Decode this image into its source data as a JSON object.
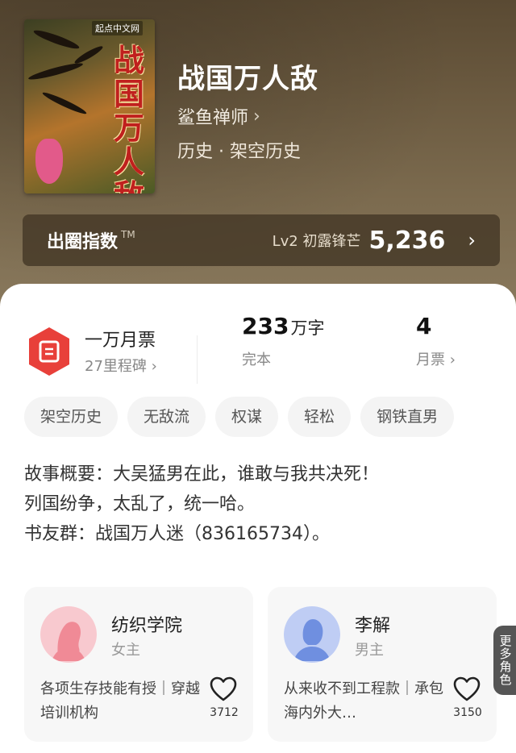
{
  "book": {
    "title": "战国万人敌",
    "author": "鲨鱼禅师",
    "genre": "历史 · 架空历史",
    "cover_art_text": "战国万人敌",
    "cover_publisher": "起点中文网"
  },
  "index_bar": {
    "label": "出圈指数",
    "tm": "TM",
    "level": "Lv2 初露锋芒",
    "value": "5,236"
  },
  "stats": {
    "monthly_badge": "一万月票",
    "milestones": "27里程碑",
    "word_count": "233",
    "word_unit": "万字",
    "status": "完本",
    "monthly_votes": "4",
    "monthly_votes_label": "月票"
  },
  "tags": [
    "架空历史",
    "无敌流",
    "权谋",
    "轻松",
    "钢铁直男"
  ],
  "summary": [
    "故事概要：大吴猛男在此，谁敢与我共决死！",
    "列国纷争，太乱了，统一哈。",
    "书友群：战国万人迷（836165734）。"
  ],
  "roles": [
    {
      "name": "纺织学院",
      "type": "女主",
      "desc": "各项生存技能有授｜穿越培训机构",
      "likes": "3712"
    },
    {
      "name": "李解",
      "type": "男主",
      "desc": "从来收不到工程款｜承包海内外大…",
      "likes": "3150"
    }
  ],
  "more_roles": "更多角色",
  "colors": {
    "ticket_red": "#e8403a",
    "hero_bg": "#6b5a40",
    "female_avatar": "#f08a96",
    "male_avatar": "#6f8fe0"
  },
  "icons": [
    "chevron-right-icon",
    "ticket-icon",
    "heart-icon"
  ]
}
